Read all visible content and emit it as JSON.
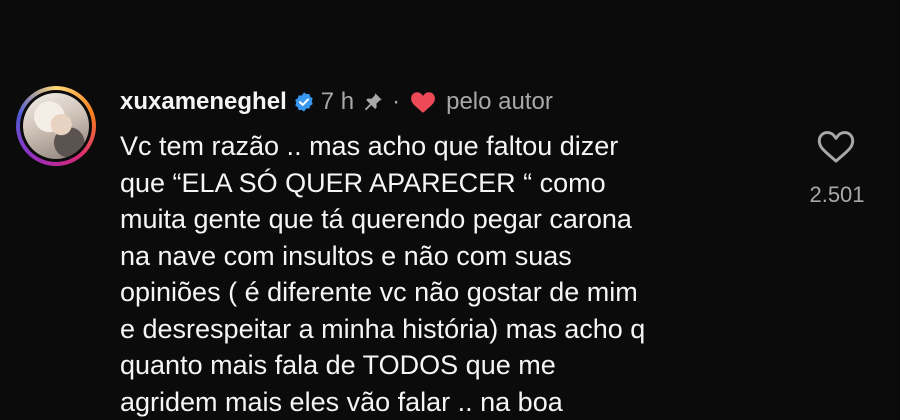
{
  "comment": {
    "username": "xuxameneghel",
    "time": "7 h",
    "separator": "·",
    "liked_by_author": "pelo autor",
    "text": "Vc tem razão .. mas acho que faltou dizer\nque “ELA SÓ QUER APARECER “ como\nmuita gente que tá querendo pegar carona\nna nave com insultos e não com suas\nopiniões ( é diferente vc não gostar de mim\ne desrespeitar a minha história) mas acho q\nquanto mais fala de TODOS que me\nagridem mais eles vão falar .. na boa",
    "like_count": "2.501"
  },
  "icons": {
    "verified": "verified-badge-icon",
    "pin": "pin-icon",
    "author_heart": "heart-filled-icon",
    "like": "heart-outline-icon"
  },
  "colors": {
    "background": "#0b0b0c",
    "verified_blue": "#3897f0",
    "heart_red": "#ed4956",
    "secondary_text": "#a8a8a8"
  }
}
